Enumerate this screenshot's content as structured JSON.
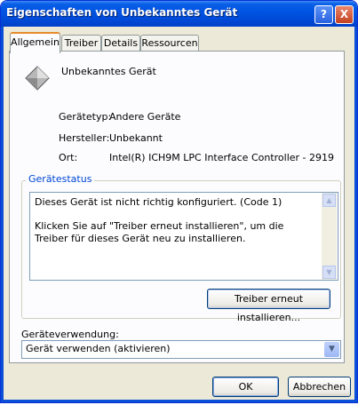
{
  "window": {
    "title": "Eigenschaften von Unbekanntes Gerät",
    "help_glyph": "?",
    "close_glyph": "X"
  },
  "tabs": [
    {
      "label": "Allgemein",
      "active": true
    },
    {
      "label": "Treiber",
      "active": false
    },
    {
      "label": "Details",
      "active": false
    },
    {
      "label": "Ressourcen",
      "active": false
    }
  ],
  "device": {
    "name": "Unbekanntes Gerät",
    "icon": "unknown-device-icon",
    "properties": [
      {
        "label": "Gerätetyp:",
        "value": "Andere Geräte"
      },
      {
        "label": "Hersteller:",
        "value": "Unbekannt"
      },
      {
        "label": "Ort:",
        "value": "Intel(R) ICH9M LPC Interface Controller - 2919"
      }
    ]
  },
  "status": {
    "group_label": "Gerätestatus",
    "line1": "Dieses Gerät ist nicht richtig konfiguriert. (Code 1)",
    "line2": "Klicken Sie auf \"Treiber erneut installieren\", um die Treiber für dieses Gerät neu zu installieren.",
    "reinstall_button": "Treiber erneut installieren..."
  },
  "usage": {
    "label": "Geräteverwendung:",
    "selected": "Gerät verwenden (aktivieren)"
  },
  "buttons": {
    "ok": "OK",
    "cancel": "Abbrechen"
  },
  "colors": {
    "titlebar": "#0054e3",
    "dialog_bg": "#ece9d8",
    "group_label": "#0046d5",
    "active_tab_accent": "#e68b2c"
  }
}
